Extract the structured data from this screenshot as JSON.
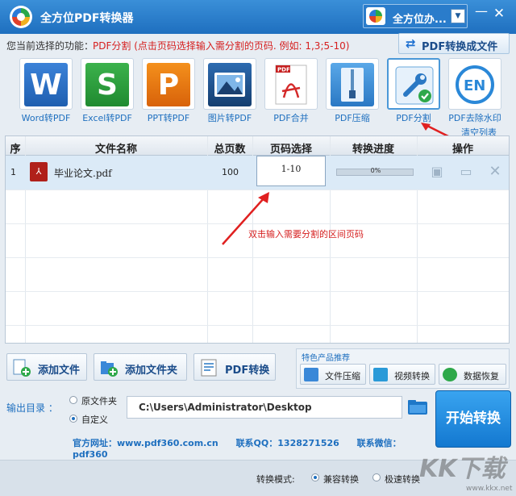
{
  "window": {
    "title": "全方位PDF转换器",
    "account_name": "全方位办...",
    "minimize": "—",
    "close": "✕"
  },
  "function_bar": {
    "label": "您当前选择的功能：",
    "value": "PDF分割 (点击页码选择输入需分割的页码. 例如: 1,3;5-10)",
    "convert_button": "PDF转换成文件"
  },
  "tools": [
    {
      "label": "Word转PDF",
      "glyph": "W",
      "color": "#2a6cc4",
      "icon": "word-icon"
    },
    {
      "label": "Excel转PDF",
      "glyph": "S",
      "color": "#2c9a3c",
      "icon": "excel-icon"
    },
    {
      "label": "PPT转PDF",
      "glyph": "P",
      "color": "#e8720c",
      "icon": "ppt-icon"
    },
    {
      "label": "图片转PDF",
      "glyph": "",
      "color": "#1c4e8a",
      "icon": "image-icon"
    },
    {
      "label": "PDF合并",
      "glyph": "",
      "color": "#ffffff",
      "icon": "pdf-merge-icon"
    },
    {
      "label": "PDF压缩",
      "glyph": "",
      "color": "#4a98d8",
      "icon": "compress-icon"
    },
    {
      "label": "PDF分割",
      "glyph": "",
      "color": "#ffffff",
      "icon": "wrench-icon"
    },
    {
      "label": "PDF去除水印",
      "glyph": "EN",
      "color": "#ffffff",
      "icon": "watermark-icon"
    }
  ],
  "clear_list": "清空列表",
  "table": {
    "headers": [
      "序",
      "文件名称",
      "总页数",
      "页码选择",
      "转换进度",
      "操作"
    ],
    "rows": [
      {
        "index": "1",
        "name": "毕业论文.pdf",
        "pages": "100",
        "range": "1-10",
        "progress": 0,
        "progress_text": "0%"
      }
    ]
  },
  "annotation": "双击输入需要分割的区间页码",
  "buttons": {
    "add_file": "添加文件",
    "add_folder": "添加文件夹",
    "pdf_convert": "PDF转换"
  },
  "featured": {
    "title": "特色产品推荐",
    "items": [
      "文件压缩",
      "视频转换",
      "数据恢复"
    ]
  },
  "output": {
    "label": "输出目录 ：",
    "option_original": "原文件夹",
    "option_custom": "自定义",
    "selected": "自定义",
    "path": "C:\\Users\\Administrator\\Desktop"
  },
  "start_button": "开始转换",
  "footer": {
    "site": "官方网址：www.pdf360.com.cn",
    "qq": "联系QQ：1328271526",
    "wechat": "联系微信：pdf360"
  },
  "mode": {
    "label": "转换模式:",
    "compatible": "兼容转换",
    "fast": "极速转换",
    "selected": "兼容转换"
  },
  "watermark": {
    "text": "KK下载",
    "url": "www.kkx.net"
  },
  "colors": {
    "accent": "#1e6fbf",
    "red": "#d62020"
  }
}
